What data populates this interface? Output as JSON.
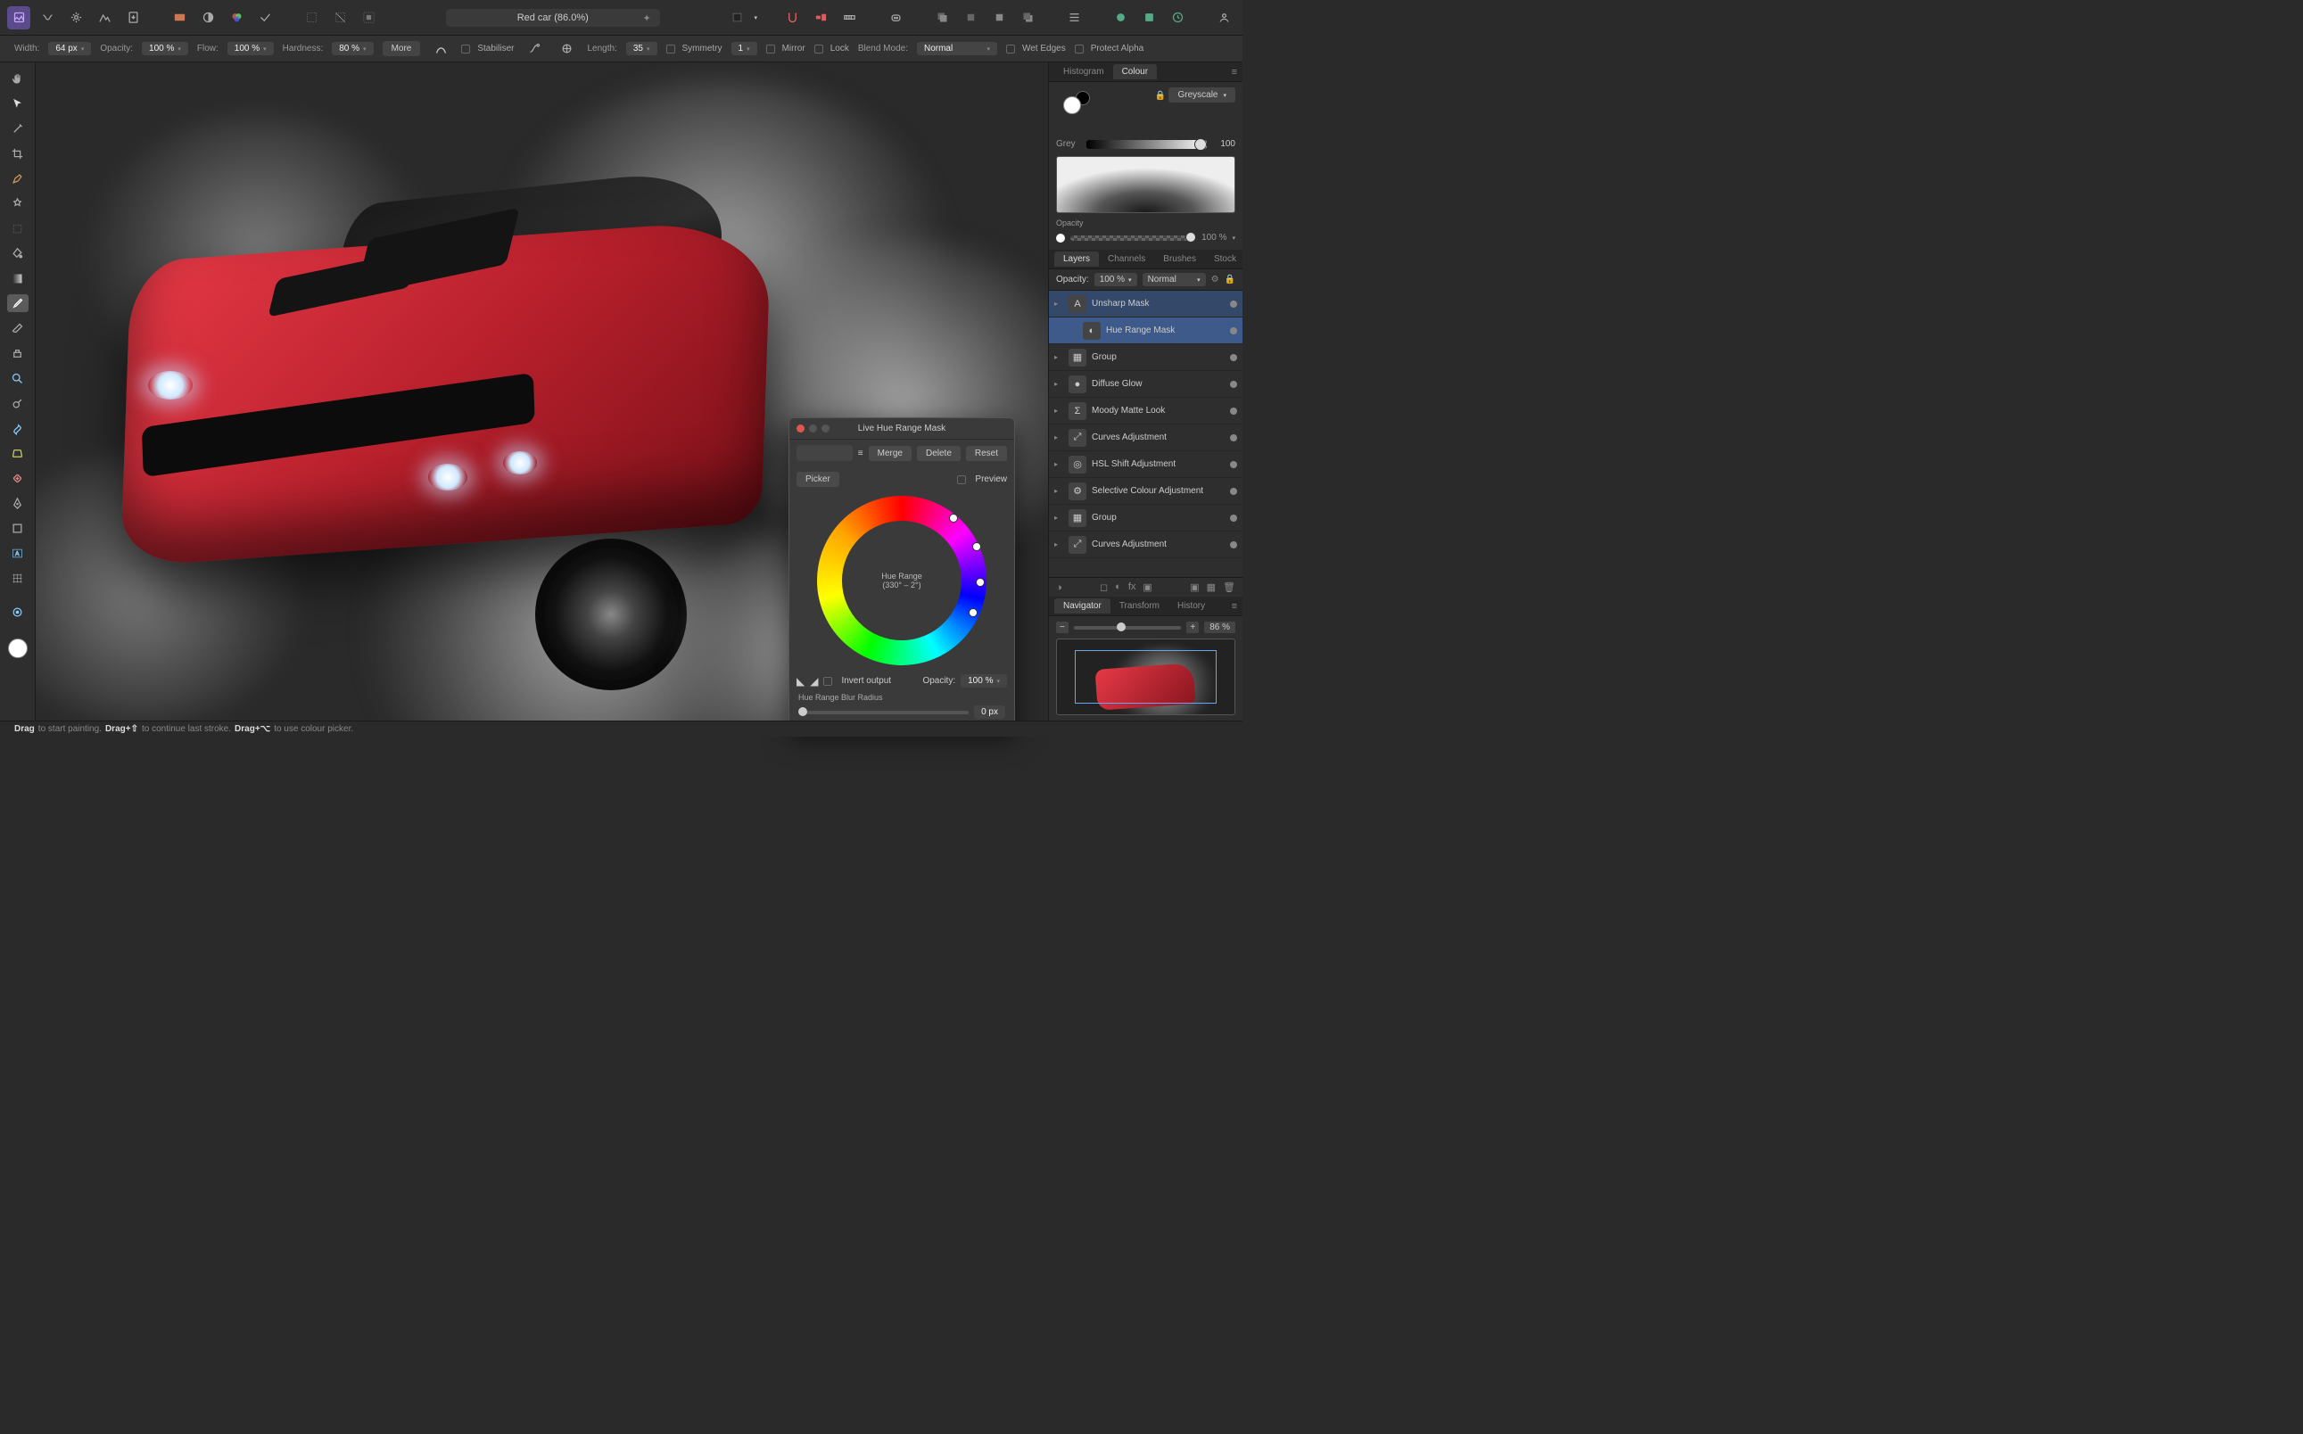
{
  "document": {
    "title": "Red car (86.0%)"
  },
  "context_toolbar": {
    "width_label": "Width:",
    "width_value": "64 px",
    "opacity_label": "Opacity:",
    "opacity_value": "100 %",
    "flow_label": "Flow:",
    "flow_value": "100 %",
    "hardness_label": "Hardness:",
    "hardness_value": "80 %",
    "more": "More",
    "stabiliser": "Stabiliser",
    "length_label": "Length:",
    "length_value": "35",
    "symmetry_label": "Symmetry",
    "symmetry_value": "1",
    "mirror": "Mirror",
    "lock": "Lock",
    "blend_label": "Blend Mode:",
    "blend_value": "Normal",
    "wet_edges": "Wet Edges",
    "protect_alpha": "Protect Alpha"
  },
  "colour_panel": {
    "tabs": [
      "Histogram",
      "Colour"
    ],
    "active_tab": "Colour",
    "mode": "Greyscale",
    "grey_label": "Grey",
    "grey_value": "100",
    "opacity_label": "Opacity",
    "opacity_value": "100 %"
  },
  "layers_panel": {
    "tabs": [
      "Layers",
      "Channels",
      "Brushes",
      "Stock"
    ],
    "active_tab": "Layers",
    "opacity_label": "Opacity:",
    "opacity_value": "100 %",
    "blend": "Normal",
    "items": [
      {
        "name": "Unsharp Mask",
        "icon": "A",
        "selected": "parent"
      },
      {
        "name": "Hue Range Mask",
        "icon": "◐",
        "selected": "true",
        "child": true
      },
      {
        "name": "Group",
        "icon": "▦"
      },
      {
        "name": "Diffuse Glow",
        "icon": "●"
      },
      {
        "name": "Moody Matte Look",
        "icon": "Σ"
      },
      {
        "name": "Curves Adjustment",
        "icon": "⤢"
      },
      {
        "name": "HSL Shift Adjustment",
        "icon": "◎"
      },
      {
        "name": "Selective Colour Adjustment",
        "icon": "⚙"
      },
      {
        "name": "Group",
        "icon": "▦"
      },
      {
        "name": "Curves Adjustment",
        "icon": "⤢"
      }
    ]
  },
  "navigator": {
    "tabs": [
      "Navigator",
      "Transform",
      "History"
    ],
    "active_tab": "Navigator",
    "zoom": "86 %"
  },
  "dialog": {
    "title": "Live Hue Range Mask",
    "merge": "Merge",
    "delete": "Delete",
    "reset": "Reset",
    "picker": "Picker",
    "preview": "Preview",
    "center_label": "Hue Range",
    "center_range": "(330° – 2°)",
    "invert": "Invert output",
    "opacity_label": "Opacity:",
    "opacity_value": "100 %",
    "blur_label": "Hue Range Blur Radius",
    "blur_value": "0 px"
  },
  "status": {
    "s1": "Drag",
    "t1": " to start painting. ",
    "s2": "Drag+⇧",
    "t2": " to continue last stroke. ",
    "s3": "Drag+⌥",
    "t3": " to use colour picker."
  }
}
